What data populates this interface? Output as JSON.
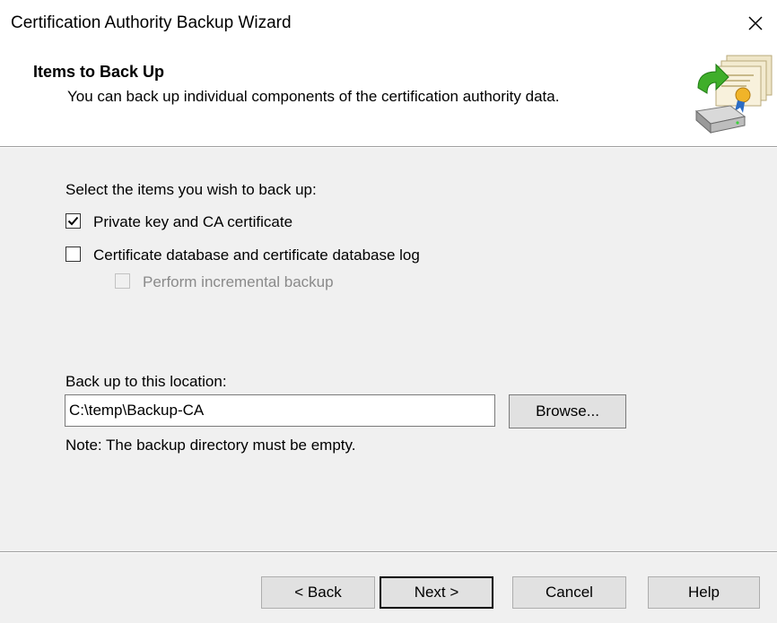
{
  "window": {
    "title": "Certification Authority Backup Wizard",
    "close_glyph": "✕"
  },
  "header": {
    "title": "Items to Back Up",
    "description": "You can back up individual components of the certification authority data.",
    "icon": "backup-certificate-icon"
  },
  "content": {
    "select_label": "Select the items you wish to back up:",
    "options": [
      {
        "label": "Private key and CA certificate",
        "checked": true,
        "enabled": true
      },
      {
        "label": "Certificate database and certificate database log",
        "checked": false,
        "enabled": true
      },
      {
        "label": "Perform incremental backup",
        "checked": false,
        "enabled": false
      }
    ],
    "location_label": "Back up to this location:",
    "location_value": "C:\\temp\\Backup-CA",
    "browse_label": "Browse...",
    "note": "Note: The backup directory must be empty."
  },
  "footer": {
    "back_label": "< Back",
    "next_label": "Next >",
    "cancel_label": "Cancel",
    "help_label": "Help"
  }
}
